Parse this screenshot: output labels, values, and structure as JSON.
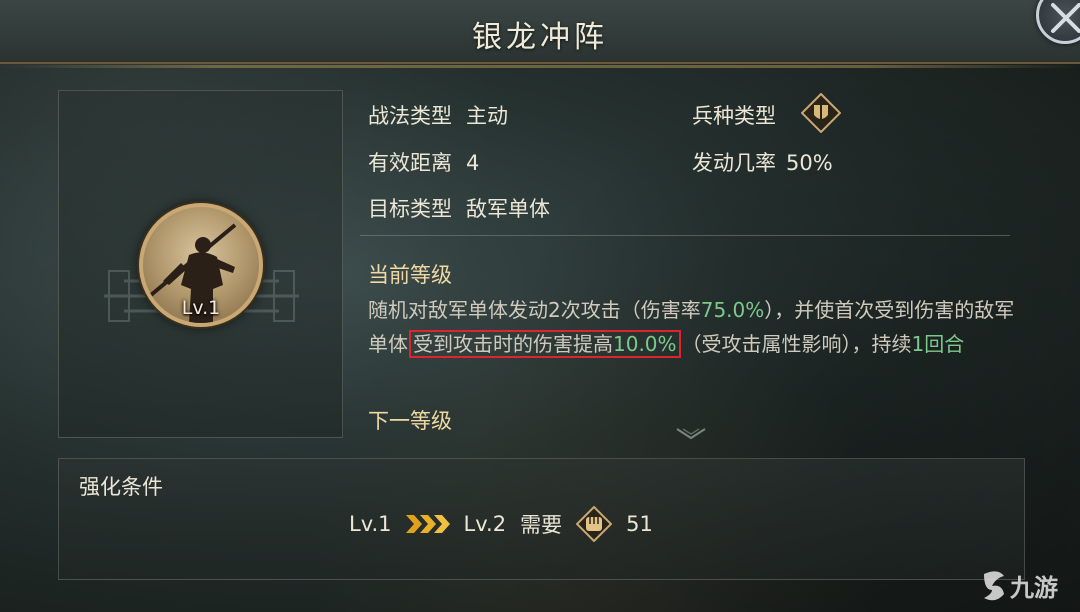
{
  "header": {
    "title": "银龙冲阵"
  },
  "skill": {
    "level": "Lv.1"
  },
  "info": {
    "tactic_type_label": "战法类型",
    "tactic_type_value": "主动",
    "range_label": "有效距离",
    "range_value": "4",
    "target_label": "目标类型",
    "target_value": "敌军单体",
    "troop_label": "兵种类型",
    "chance_label": "发动几率",
    "chance_value": "50%"
  },
  "current_level": {
    "title": "当前等级",
    "desc_part1": "随机对敌军单体发动2次攻击（伤害率",
    "desc_rate": "75.0%",
    "desc_part2": "），并使首次受到伤害的敌军单体",
    "desc_highlight_text": "受到攻击时的伤害提高",
    "desc_highlight_value": "10.0%",
    "desc_part3": "（受攻击属性影响），持续",
    "desc_duration": "1回合",
    "next_title": "下一等级"
  },
  "enhance": {
    "title": "强化条件",
    "from_level": "Lv.1",
    "to_level": "Lv.2",
    "need_label": "需要",
    "cost": "51"
  },
  "watermark": {
    "text": "九游"
  },
  "icons": {
    "close": "close-icon",
    "troop": "shield-troop-icon",
    "arrows": "triple-chevron-icon",
    "cost": "fist-token-icon",
    "chevron": "chevron-down-icon"
  },
  "colors": {
    "accent_green": "#7cc98c",
    "highlight_red": "#e0242b",
    "gold": "#c9a873"
  }
}
